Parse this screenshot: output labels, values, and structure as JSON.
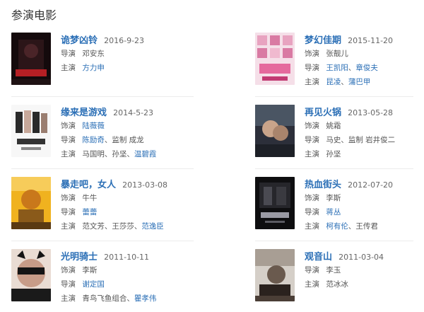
{
  "section_title": "参演电影",
  "movies": [
    {
      "title": "诡梦凶铃",
      "date": "2016-9-23",
      "director_label": "导演",
      "director": "邓安东",
      "cast_label": "主演",
      "cast": "方力申",
      "poster_colors": [
        "#1b0e10",
        "#5a1013",
        "#b51f24"
      ]
    },
    {
      "title": "梦幻佳期",
      "date": "2015-11-20",
      "role_label": "饰演",
      "role": "张靓儿",
      "director_label": "导演",
      "director_1": "王凯阳",
      "director_sep": "、",
      "director_2": "章俊夫",
      "cast_label": "主演",
      "cast_1": "昆凌",
      "cast_sep": "、",
      "cast_2": "蒲巴甲",
      "poster_colors": [
        "#f4d6e3",
        "#e5699d",
        "#c23a73"
      ]
    },
    {
      "title": "缘来是游戏",
      "date": "2014-5-23",
      "role_label": "饰演",
      "role": "陆薇薇",
      "director_label": "导演",
      "director": "陈励奇",
      "director_extra": "、监制 成龙",
      "cast_label": "主演",
      "cast_1": "马国明",
      "cast_sep": "、",
      "cast_2": "孙坚",
      "cast_sep2": "、",
      "cast_3": "温碧霞",
      "poster_colors": [
        "#f6f6f6",
        "#2a2a2a",
        "#d8d0c8"
      ]
    },
    {
      "title": "再见火锅",
      "date": "2013-05-28",
      "role_label": "饰演",
      "role": "姚霜",
      "director_label": "导演",
      "director_text": "马史、监制 岩井俊二",
      "cast_label": "主演",
      "cast": "孙坚",
      "poster_colors": [
        "#2c2f3a",
        "#7a8a9a",
        "#c9a48a"
      ]
    },
    {
      "title": "暴走吧，女人",
      "date": "2013-03-08",
      "role_label": "饰演",
      "role": "牛牛",
      "director_label": "导演",
      "director": "蕾蕾",
      "cast_label": "主演",
      "cast_text": "范文芳、王莎莎、",
      "cast_link": "范逸臣",
      "poster_colors": [
        "#f0b21f",
        "#c9781b",
        "#5a3a12"
      ]
    },
    {
      "title": "热血街头",
      "date": "2012-07-20",
      "role_label": "饰演",
      "role": "李斯",
      "director_label": "导演",
      "director": "蒋丛",
      "cast_label": "主演",
      "cast_1": "柯有伦",
      "cast_sep": "、",
      "cast_2": "王传君",
      "poster_colors": [
        "#0e0e10",
        "#3a3a40",
        "#9a9aa4"
      ]
    },
    {
      "title": "光明骑士",
      "date": "2011-10-11",
      "role_label": "饰演",
      "role": "李斯",
      "director_label": "导演",
      "director": "谢定国",
      "cast_label": "主演",
      "cast_text": "青鸟飞鱼组合、",
      "cast_link": "瞿孝伟",
      "poster_colors": [
        "#e9dcd3",
        "#141414",
        "#b98a78"
      ]
    },
    {
      "title": "观音山",
      "date": "2011-03-04",
      "director_label": "导演",
      "director_text": "李玉",
      "cast_label": "主演",
      "cast": "范冰冰",
      "poster_colors": [
        "#d5cfc8",
        "#6a5a4e",
        "#2a221e"
      ]
    }
  ]
}
